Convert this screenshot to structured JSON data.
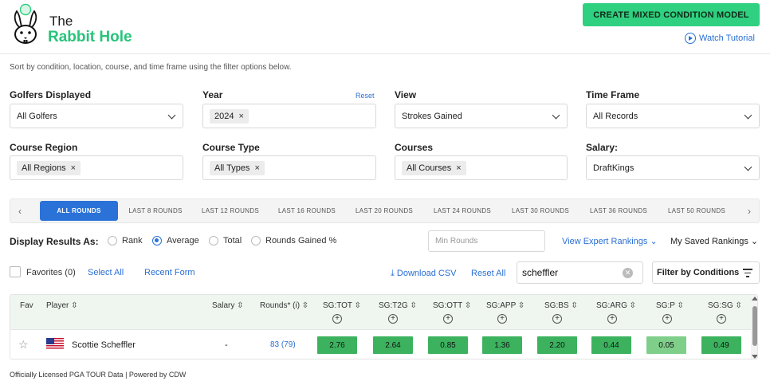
{
  "brand": {
    "line1": "The",
    "line2": "Rabbit Hole"
  },
  "header": {
    "create_button": "CREATE MIXED CONDITION MODEL",
    "watch_tutorial": "Watch Tutorial"
  },
  "subtitle": "Sort by condition, location, course, and time frame using the filter options below.",
  "filters": {
    "golfers": {
      "label": "Golfers Displayed",
      "value": "All Golfers"
    },
    "year": {
      "label": "Year",
      "chip": "2024",
      "reset": "Reset"
    },
    "view": {
      "label": "View",
      "value": "Strokes Gained"
    },
    "time_frame": {
      "label": "Time Frame",
      "value": "All Records"
    },
    "course_region": {
      "label": "Course Region",
      "chip": "All Regions"
    },
    "course_type": {
      "label": "Course Type",
      "chip": "All Types"
    },
    "courses": {
      "label": "Courses",
      "chip": "All Courses"
    },
    "salary": {
      "label": "Salary:",
      "value": "DraftKings"
    },
    "chip_remove": "×"
  },
  "round_tabs": [
    "ALL ROUNDS",
    "LAST 8 ROUNDS",
    "LAST 12 ROUNDS",
    "LAST 16 ROUNDS",
    "LAST 20 ROUNDS",
    "LAST 24 ROUNDS",
    "LAST 30 ROUNDS",
    "LAST 36 ROUNDS",
    "LAST 50 ROUNDS"
  ],
  "nav": {
    "prev": "‹",
    "next": "›"
  },
  "display": {
    "label": "Display Results As:",
    "options": [
      "Rank",
      "Average",
      "Total",
      "Rounds Gained %"
    ],
    "selected": "Average",
    "min_rounds_placeholder": "Min Rounds",
    "expert_rankings": "View Expert Rankings ⌄",
    "saved_rankings": "My Saved Rankings ⌄"
  },
  "actions": {
    "favorites": "Favorites (0)",
    "select_all": "Select All",
    "recent_form": "Recent Form",
    "download_csv": "⤓ Download CSV",
    "reset_all": "Reset All",
    "search_value": "scheffler",
    "filter_conditions": "Filter by Conditions"
  },
  "table": {
    "headers": {
      "fav": "Fav",
      "player": "Player ⇳",
      "salary": "Salary ⇳",
      "rounds": "Rounds* (i) ⇳",
      "sg_tot": "SG:TOT ⇳",
      "sg_t2g": "SG:T2G ⇳",
      "sg_ott": "SG:OTT ⇳",
      "sg_app": "SG:APP ⇳",
      "sg_bs": "SG:BS ⇳",
      "sg_arg": "SG:ARG ⇳",
      "sg_p": "SG:P ⇳",
      "sg_sg": "SG:SG ⇳"
    },
    "plus": "+",
    "rows": [
      {
        "fav": "☆",
        "player": "Scottie Scheffler",
        "salary": "-",
        "rounds": "83 (79)",
        "sg_tot": "2.76",
        "sg_t2g": "2.64",
        "sg_ott": "0.85",
        "sg_app": "1.36",
        "sg_bs": "2.20",
        "sg_arg": "0.44",
        "sg_p": "0.05",
        "sg_sg": "0.49"
      }
    ]
  },
  "colors": {
    "accent_green": "#2fd07f",
    "link_blue": "#2a6fd6",
    "tab_blue": "#2a72d8",
    "cell_dark": "#3cb25f",
    "cell_light": "#7fcf8a"
  },
  "footer": "Officially Licensed PGA TOUR Data | Powered by CDW"
}
